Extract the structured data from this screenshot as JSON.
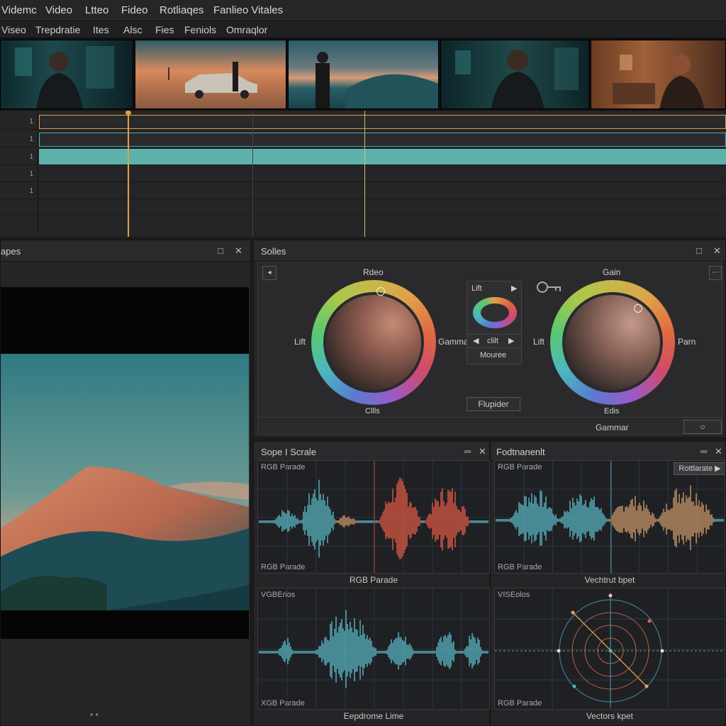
{
  "menu": [
    "Videmc",
    "Video",
    "Ltteo",
    "Fideo",
    "Rotliaqes",
    "Fanlieo Vitales"
  ],
  "tabs": [
    "Viseo",
    "Trepdratie",
    "Ites",
    "Alsc",
    "Fies",
    "Feniols",
    "Omraqlor"
  ],
  "track_numbers": [
    "1",
    "1",
    "1",
    "1",
    "1"
  ],
  "viewer": {
    "title": "apes",
    "pagination": "• •"
  },
  "grade": {
    "title": "Solles",
    "wheel1": {
      "top": "Rdeo",
      "left": "Lift",
      "right": "Gamma",
      "bottom": "Cllls"
    },
    "wheel2": {
      "top": "Gain",
      "left": "Lift",
      "right": "Parn",
      "bottom": "Edis"
    },
    "mini": {
      "title": "Lift",
      "cycle": "clilt",
      "mode": "Mouree"
    },
    "picker_button": "Flupider",
    "footer_label": "Gammar"
  },
  "scope_left": {
    "title": "Sope I Scrale",
    "tl": "RGB Parade",
    "bl": "RGB Parade",
    "caption": "RGB Parade",
    "tl2": "VGBErios",
    "bl2": "XGB Parade",
    "caption2": "Eepdrome Lime"
  },
  "scope_right": {
    "title": "Fodtnanenlt",
    "tl": "RGB Parade",
    "bl": "RGB Parade",
    "caption": "Vechtrut bpet",
    "button": "Rottlarate",
    "tl2": "VISEolos",
    "bl2": "RGB Parade",
    "caption2": "Vectors kpet"
  },
  "colors": {
    "accent_orange": "#e3a04a",
    "accent_teal": "#4fb2b3",
    "wave_teal": "#5bb8c4",
    "wave_red": "#e05a44",
    "wave_tan": "#c9996a"
  }
}
